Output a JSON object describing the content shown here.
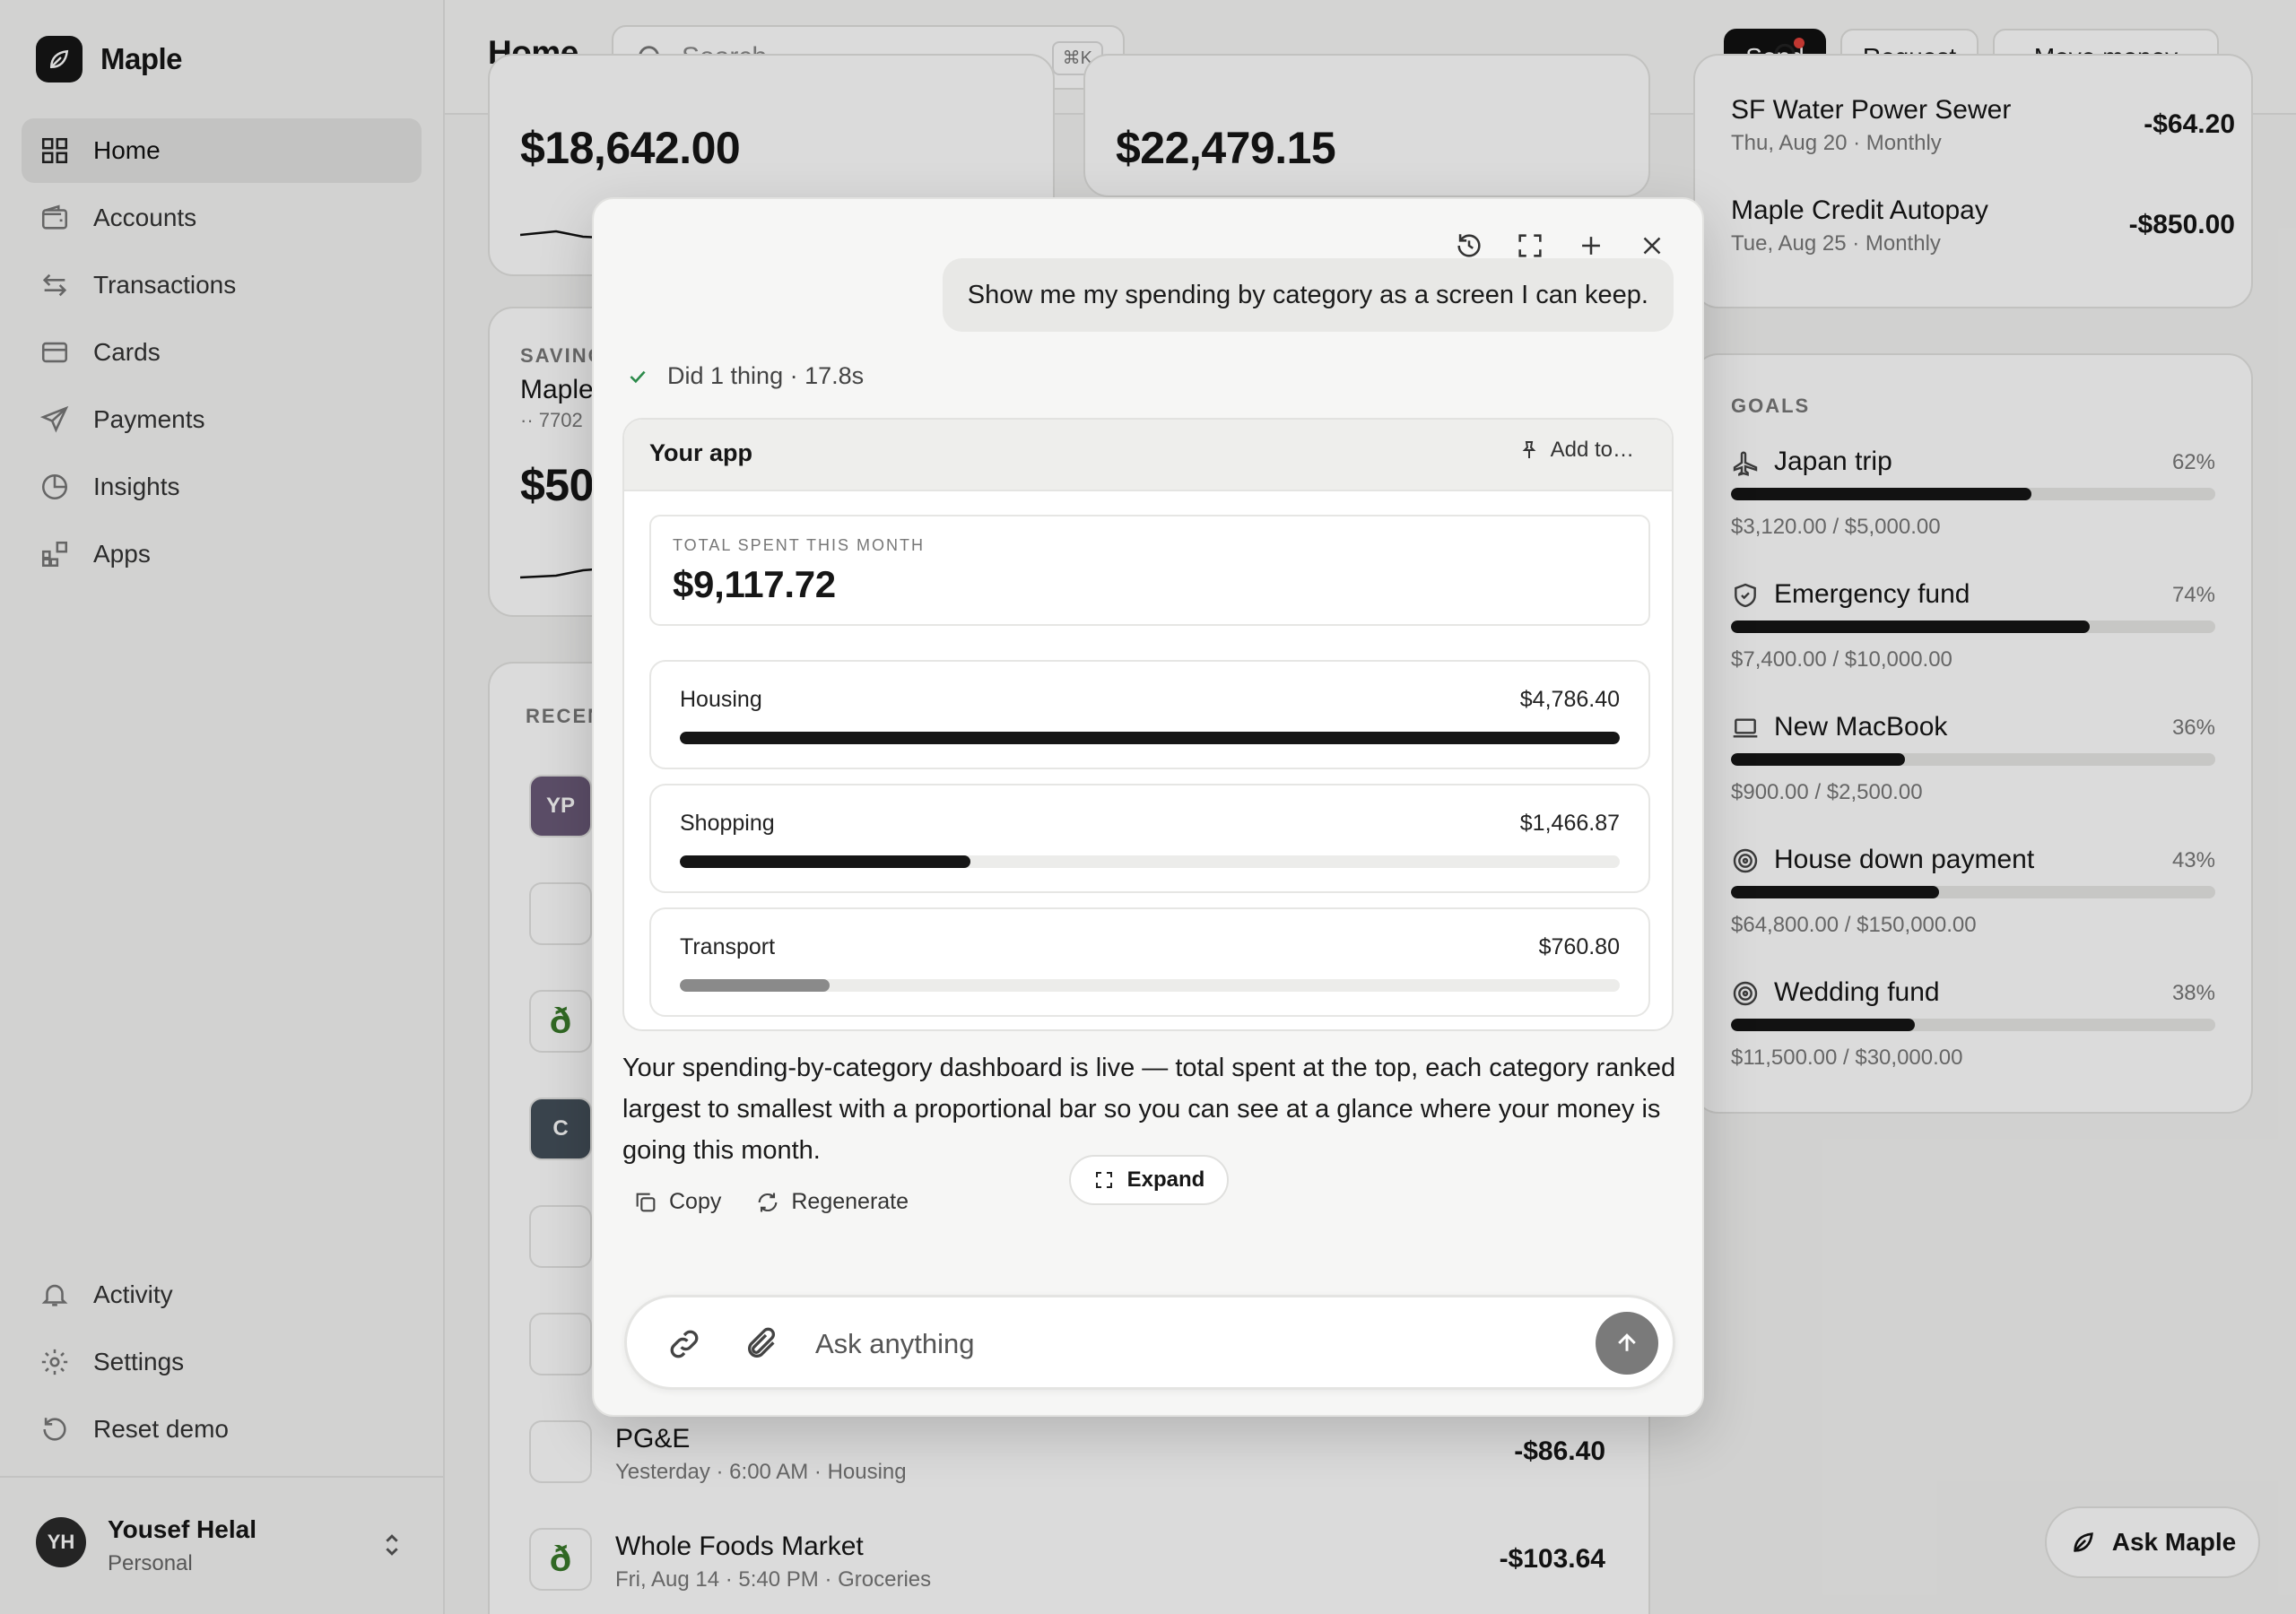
{
  "app": {
    "name": "Maple"
  },
  "sidebar": {
    "items": [
      {
        "label": "Home",
        "icon": "grid-icon"
      },
      {
        "label": "Accounts",
        "icon": "wallet-icon"
      },
      {
        "label": "Transactions",
        "icon": "arrows-swap-icon"
      },
      {
        "label": "Cards",
        "icon": "card-icon"
      },
      {
        "label": "Payments",
        "icon": "send-icon"
      },
      {
        "label": "Insights",
        "icon": "pie-icon"
      },
      {
        "label": "Apps",
        "icon": "apps-icon"
      }
    ],
    "bottom_items": [
      {
        "label": "Activity",
        "icon": "bell-icon"
      },
      {
        "label": "Settings",
        "icon": "gear-icon"
      },
      {
        "label": "Reset demo",
        "icon": "reset-icon"
      }
    ],
    "user": {
      "initials": "YH",
      "name": "Yousef Helal",
      "plan": "Personal"
    }
  },
  "topbar": {
    "title": "Home",
    "search_placeholder": "Search...",
    "search_shortcut": "⌘K",
    "send_label": "Send",
    "request_label": "Request",
    "move_money_label": "Move money"
  },
  "background": {
    "balance_1": "$18,642.00",
    "balance_2": "$22,479.15",
    "savings_label": "SAVING",
    "savings_name": "Maple",
    "savings_mask": "·· 7702",
    "savings_amount": "$50",
    "recent_label": "RECEN",
    "transactions": [
      {
        "initials": "YP",
        "color": "#6b5a78",
        "name": "",
        "sub": "",
        "amount": ""
      },
      {
        "initials": "",
        "color": "#ffffff",
        "name": "",
        "sub": "",
        "amount": ""
      },
      {
        "initials": "ð",
        "color": "#ffffff",
        "name": "",
        "sub": "",
        "amount": ""
      },
      {
        "initials": "C",
        "color": "#44505a",
        "name": "",
        "sub": "",
        "amount": ""
      },
      {
        "initials": "",
        "color": "#ffffff",
        "name": "",
        "sub": "",
        "amount": ""
      },
      {
        "initials": "",
        "color": "#ffffff",
        "name": "",
        "sub": "",
        "amount": ""
      },
      {
        "initials": "",
        "color": "#ffffff",
        "name": "PG&E",
        "sub": "Yesterday · 6:00 AM · Housing",
        "amount": "-$86.40"
      },
      {
        "initials": "ð",
        "color": "#ffffff",
        "name": "Whole Foods Market",
        "sub": "Fri, Aug 14 · 5:40 PM · Groceries",
        "amount": "-$103.64"
      }
    ],
    "bills": [
      {
        "name": "SF Water Power Sewer",
        "sub": "Thu, Aug 20 · Monthly",
        "amount": "-$64.20"
      },
      {
        "name": "Maple Credit Autopay",
        "sub": "Tue, Aug 25 · Monthly",
        "amount": "-$850.00"
      }
    ],
    "goals_label": "GOALS",
    "goals": [
      {
        "name": "Japan trip",
        "pct": "62%",
        "progress": 0.62,
        "saved": "$3,120.00",
        "target": "/ $5,000.00",
        "icon": "plane-icon"
      },
      {
        "name": "Emergency fund",
        "pct": "74%",
        "progress": 0.74,
        "saved": "$7,400.00",
        "target": "/ $10,000.00",
        "icon": "shield-icon"
      },
      {
        "name": "New MacBook",
        "pct": "36%",
        "progress": 0.36,
        "saved": "$900.00",
        "target": "/ $2,500.00",
        "icon": "laptop-icon"
      },
      {
        "name": "House down payment",
        "pct": "43%",
        "progress": 0.43,
        "saved": "$64,800.00",
        "target": "/ $150,000.00",
        "icon": "target-icon"
      },
      {
        "name": "Wedding fund",
        "pct": "38%",
        "progress": 0.38,
        "saved": "$11,500.00",
        "target": "/ $30,000.00",
        "icon": "target-icon"
      }
    ],
    "ask_label": "Ask Maple"
  },
  "dialog": {
    "user_message": "Show me my spending by category as a screen I can keep.",
    "status": "Did 1 thing · 17.8s",
    "app_title": "Your app",
    "add_to_label": "Add to…",
    "total_label": "TOTAL SPENT THIS MONTH",
    "total_value": "$9,117.72",
    "categories": [
      {
        "name": "Housing",
        "amount": "$4,786.40",
        "share": 1.0,
        "color": "#161616"
      },
      {
        "name": "Shopping",
        "amount": "$1,466.87",
        "share": 0.309,
        "color": "#161616"
      },
      {
        "name": "Transport",
        "amount": "$760.80",
        "share": 0.159,
        "color": "#8a8a8a"
      }
    ],
    "expand_label": "Expand",
    "reply": "Your spending-by-category dashboard is live — total spent at the top, each category ranked largest to smallest with a proportional bar so you can see at a glance where your money is going this month.",
    "copy_label": "Copy",
    "regenerate_label": "Regenerate",
    "composer_placeholder": "Ask anything"
  }
}
